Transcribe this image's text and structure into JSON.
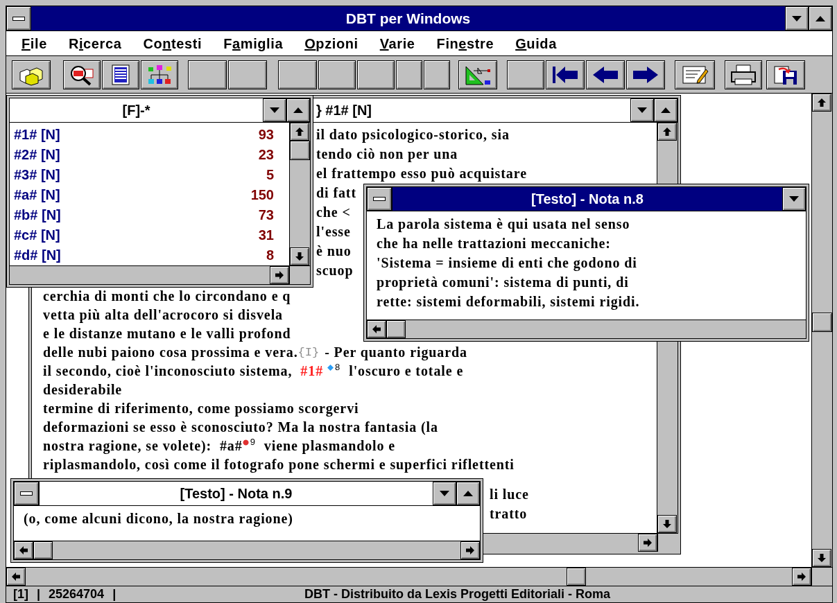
{
  "window": {
    "title": "DBT per Windows"
  },
  "menu": [
    {
      "key": "F",
      "after": "ile"
    },
    {
      "before": "R",
      "key": "i",
      "after": "cerca"
    },
    {
      "before": "Co",
      "key": "n",
      "after": "testi"
    },
    {
      "before": "F",
      "key": "a",
      "after": "miglia"
    },
    {
      "key": "O",
      "after": "pzioni"
    },
    {
      "key": "V",
      "after": "arie"
    },
    {
      "before": "Fin",
      "key": "e",
      "after": "stre"
    },
    {
      "key": "G",
      "after": "uida"
    }
  ],
  "list_window": {
    "title": "[F]-*",
    "items": [
      {
        "label": "#1# [N]",
        "count": "93"
      },
      {
        "label": "#2# [N]",
        "count": "23"
      },
      {
        "label": "#3# [N]",
        "count": "5"
      },
      {
        "label": "#a# [N]",
        "count": "150"
      },
      {
        "label": "#b# [N]",
        "count": "73"
      },
      {
        "label": "#c# [N]",
        "count": "31"
      },
      {
        "label": "#d# [N]",
        "count": "8"
      }
    ]
  },
  "text_window": {
    "title": "} #1# [N]",
    "lines_top": [
      "il dato psicologico-storico, sia",
      "tendo ciò non per una",
      "el frattempo esso può acquistare",
      "di fatt",
      "che <",
      "l'esse",
      "è nuo",
      "scuop"
    ],
    "lines_middle": [
      "cerchia di monti che lo circondano e q",
      "vetta più alta dell'acrocoro si disvela",
      "e le distanze mutano e le valli profond",
      [
        {
          "kind": "text",
          "text": "delle nubi paiono cosa prossima e vera."
        },
        {
          "kind": "tag",
          "text": "{I}"
        },
        {
          "kind": "text",
          "text": "- Per quanto riguarda"
        }
      ],
      [
        {
          "kind": "text",
          "text": "il secondo, cioè l'inconosciuto sistema,"
        },
        {
          "kind": "ref",
          "text": "#1#"
        },
        {
          "kind": "note",
          "color": "#2a9df4",
          "text": "8"
        },
        {
          "kind": "text",
          "text": "l'oscuro e totale e"
        }
      ],
      "desiderabile",
      "termine di riferimento, come possiamo scorgervi",
      "deformazioni se esso è sconosciuto? Ma la nostra fantasia (la",
      [
        {
          "kind": "text",
          "text": "nostra ragione, se volete):  #a#"
        },
        {
          "kind": "note",
          "color": "#e03030",
          "text": "9"
        },
        {
          "kind": "text",
          "text": "viene plasmandolo e"
        }
      ],
      "riplasmandolo, così come il fotografo pone schermi e superfici riflettenti"
    ],
    "lines_bottom": [
      "li luce",
      "tratto"
    ]
  },
  "note_windows": [
    {
      "title": "[Testo] - Nota n.8",
      "active": true,
      "lines": [
        "La parola sistema è qui usata nel senso",
        "che ha nelle trattazioni meccaniche:",
        "'Sistema = insieme di enti che godono di",
        "proprietà comuni': sistema di punti, di",
        "rette: sistemi deformabili, sistemi rigidi."
      ]
    },
    {
      "title": "[Testo] - Nota n.9",
      "active": false,
      "lines": [
        "(o, come alcuni dicono, la nostra ragione)"
      ]
    }
  ],
  "status_bar": {
    "fields": [
      "[1]",
      "|",
      "25264704",
      "|"
    ],
    "message": "DBT - Distribuito da Lexis Progetti Editoriali - Roma"
  }
}
